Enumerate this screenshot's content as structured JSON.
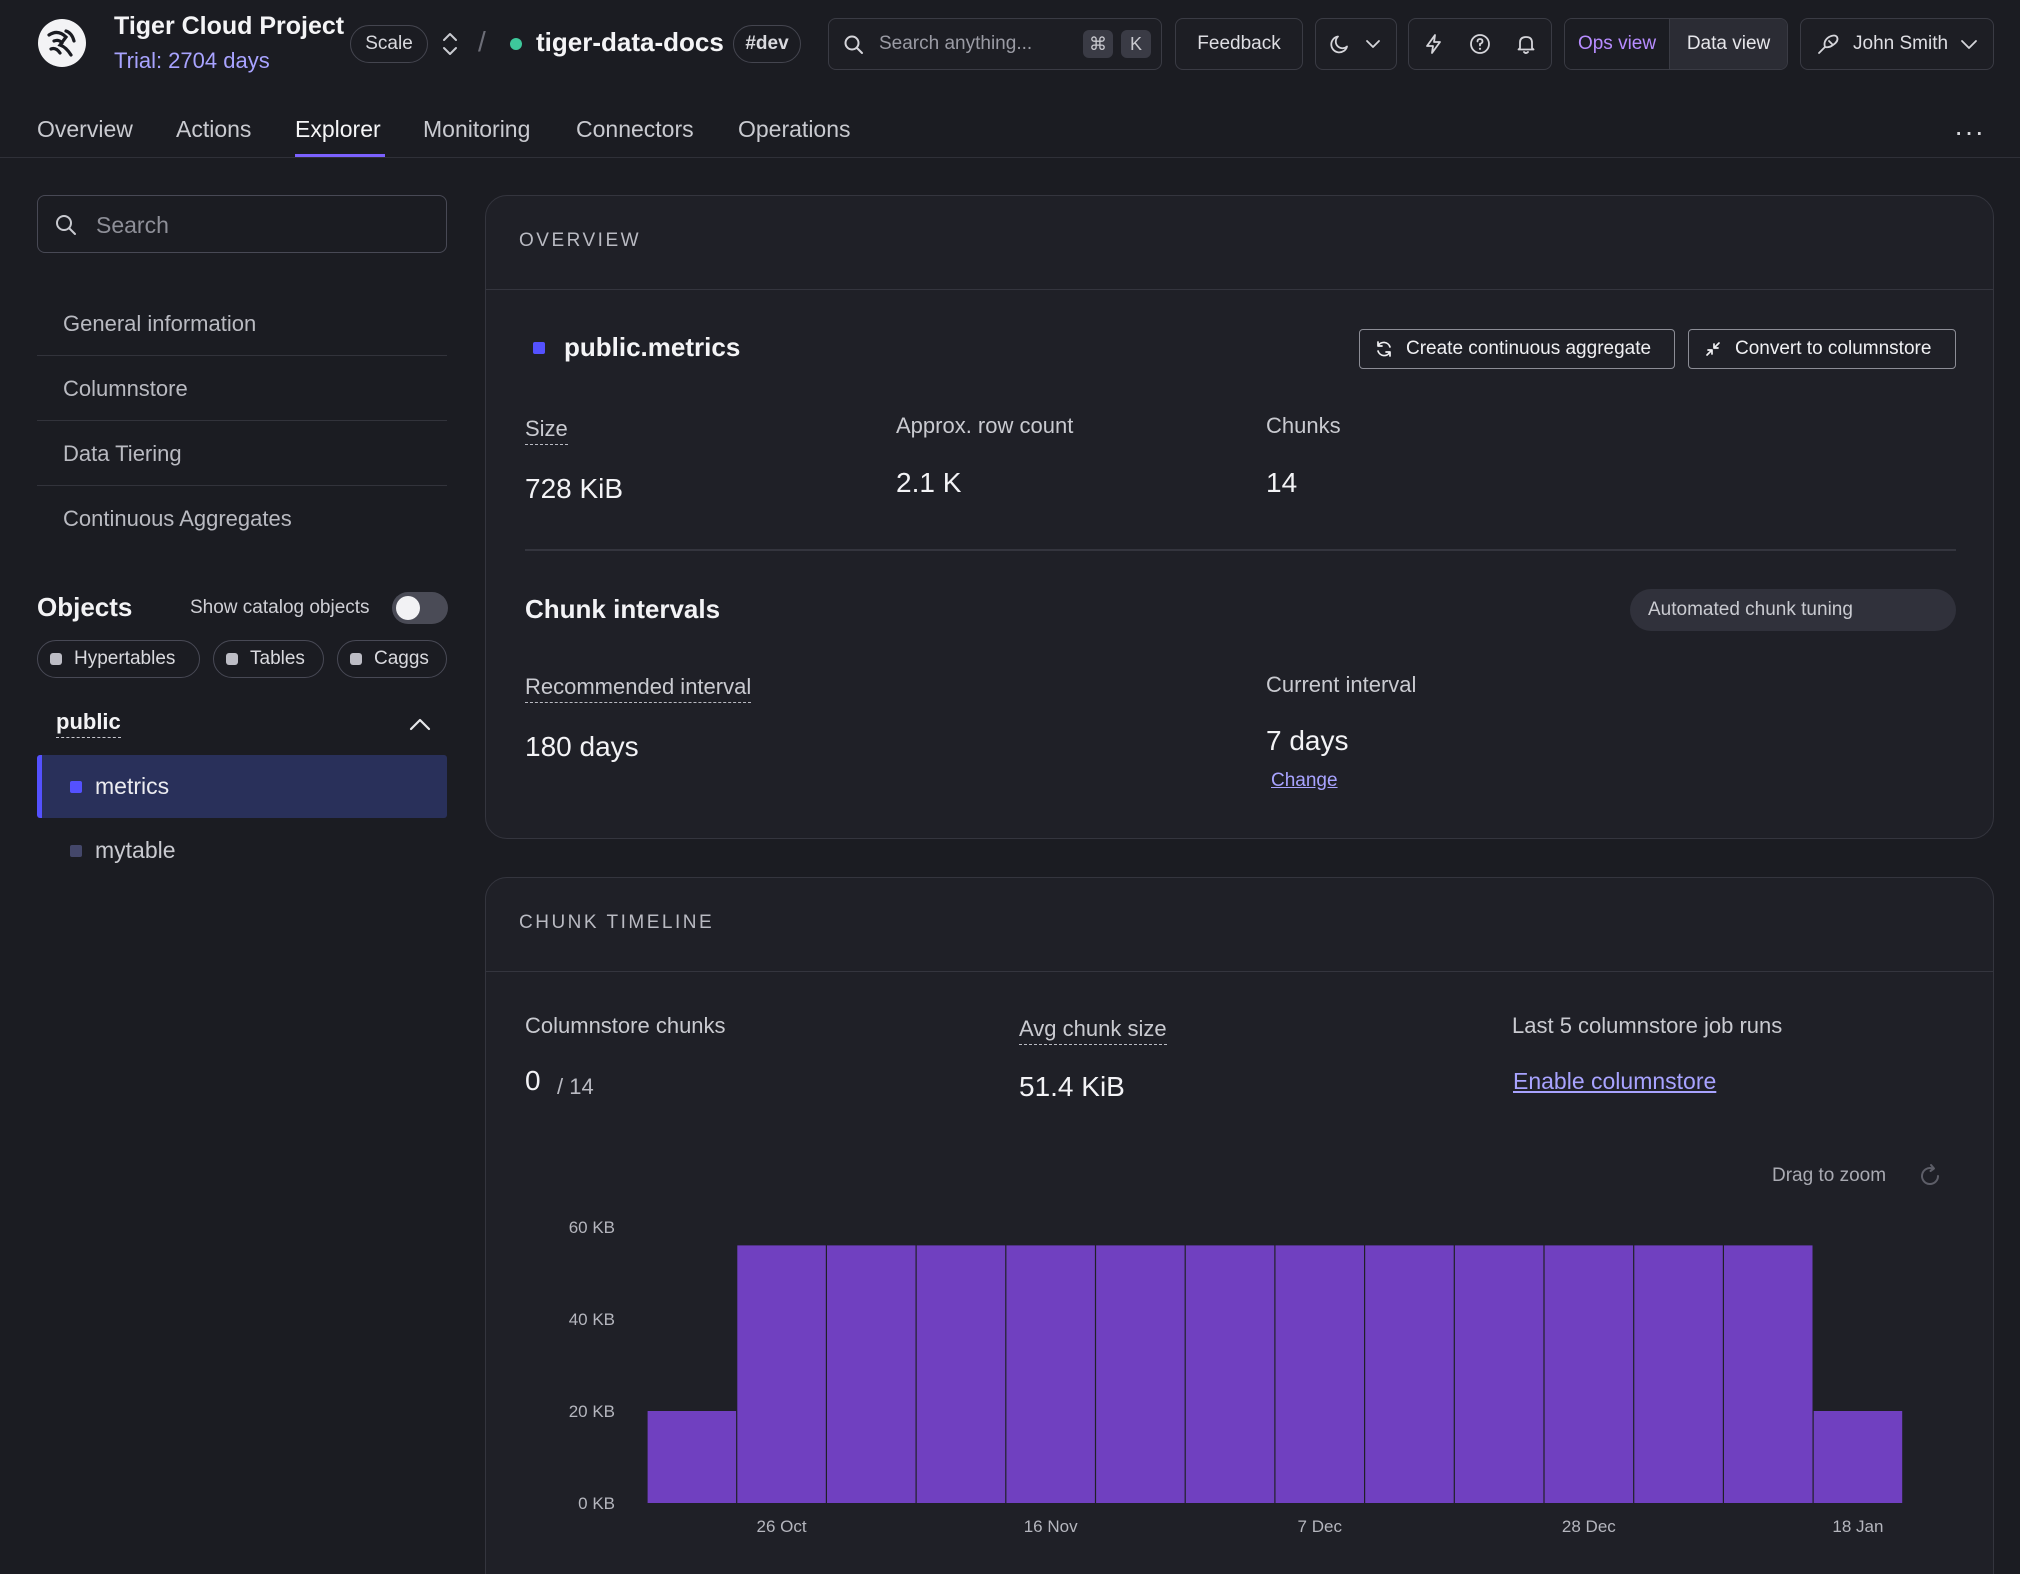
{
  "header": {
    "project_title": "Tiger Cloud Project",
    "trial": "Trial: 2704 days",
    "plan_badge": "Scale",
    "separator": "/",
    "service_name": "tiger-data-docs",
    "env_badge": "#dev",
    "search_placeholder": "Search anything...",
    "shortcut_mod": "⌘",
    "shortcut_key": "K",
    "feedback_label": "Feedback",
    "ops_view_label": "Ops view",
    "data_view_label": "Data view",
    "user_name": "John Smith",
    "service_status_color": "#3ec89b",
    "accent_color": "#a8a3ff"
  },
  "nav": {
    "tabs": [
      {
        "label": "Overview"
      },
      {
        "label": "Actions"
      },
      {
        "label": "Explorer"
      },
      {
        "label": "Monitoring"
      },
      {
        "label": "Connectors"
      },
      {
        "label": "Operations"
      }
    ],
    "active_tab": "Explorer",
    "more_label": "···"
  },
  "sidebar": {
    "search_placeholder": "Search",
    "items": [
      {
        "label": "General information"
      },
      {
        "label": "Columnstore"
      },
      {
        "label": "Data Tiering"
      },
      {
        "label": "Continuous Aggregates"
      }
    ],
    "objects_title": "Objects",
    "show_catalog_label": "Show catalog objects",
    "show_catalog_enabled": false,
    "filters": [
      {
        "label": "Hypertables"
      },
      {
        "label": "Tables"
      },
      {
        "label": "Caggs"
      }
    ],
    "schema": "public",
    "tables": [
      {
        "label": "metrics",
        "selected": true
      },
      {
        "label": "mytable",
        "selected": false
      }
    ]
  },
  "overview": {
    "section_title": "OVERVIEW",
    "table_name": "public.metrics",
    "create_cagg_label": "Create continuous aggregate",
    "convert_label": "Convert to columnstore",
    "size_label": "Size",
    "size_value": "728 KiB",
    "row_count_label": "Approx. row count",
    "row_count_value": "2.1 K",
    "chunks_label": "Chunks",
    "chunks_value": "14",
    "chunk_intervals_title": "Chunk intervals",
    "auto_tuning_label": "Automated chunk tuning",
    "auto_tuning_enabled": false,
    "recommended_label": "Recommended interval",
    "recommended_value": "180 days",
    "current_label": "Current interval",
    "current_value": "7 days",
    "change_label": "Change"
  },
  "timeline": {
    "section_title": "CHUNK TIMELINE",
    "columnstore_chunks_label": "Columnstore chunks",
    "columnstore_chunks_value": "0",
    "columnstore_chunks_total": "/ 14",
    "avg_chunk_label": "Avg chunk size",
    "avg_chunk_value": "51.4 KiB",
    "job_runs_label": "Last 5 columnstore job runs",
    "enable_label": "Enable columnstore",
    "drag_zoom_label": "Drag to zoom"
  },
  "chart_data": {
    "type": "bar",
    "values": [
      20,
      56,
      56,
      56,
      56,
      56,
      56,
      56,
      56,
      56,
      56,
      56,
      56,
      20
    ],
    "unit": "KB",
    "ylim": [
      0,
      60
    ],
    "y_ticks": [
      "0 KB",
      "20 KB",
      "40 KB",
      "60 KB"
    ],
    "x_tick_labels": [
      "26 Oct",
      "16 Nov",
      "7 Dec",
      "28 Dec",
      "18 Jan"
    ],
    "x_tick_bar_index": [
      1,
      4,
      7,
      10,
      13
    ],
    "bar_color": "#7040c0",
    "grid": false,
    "legend": "none"
  }
}
